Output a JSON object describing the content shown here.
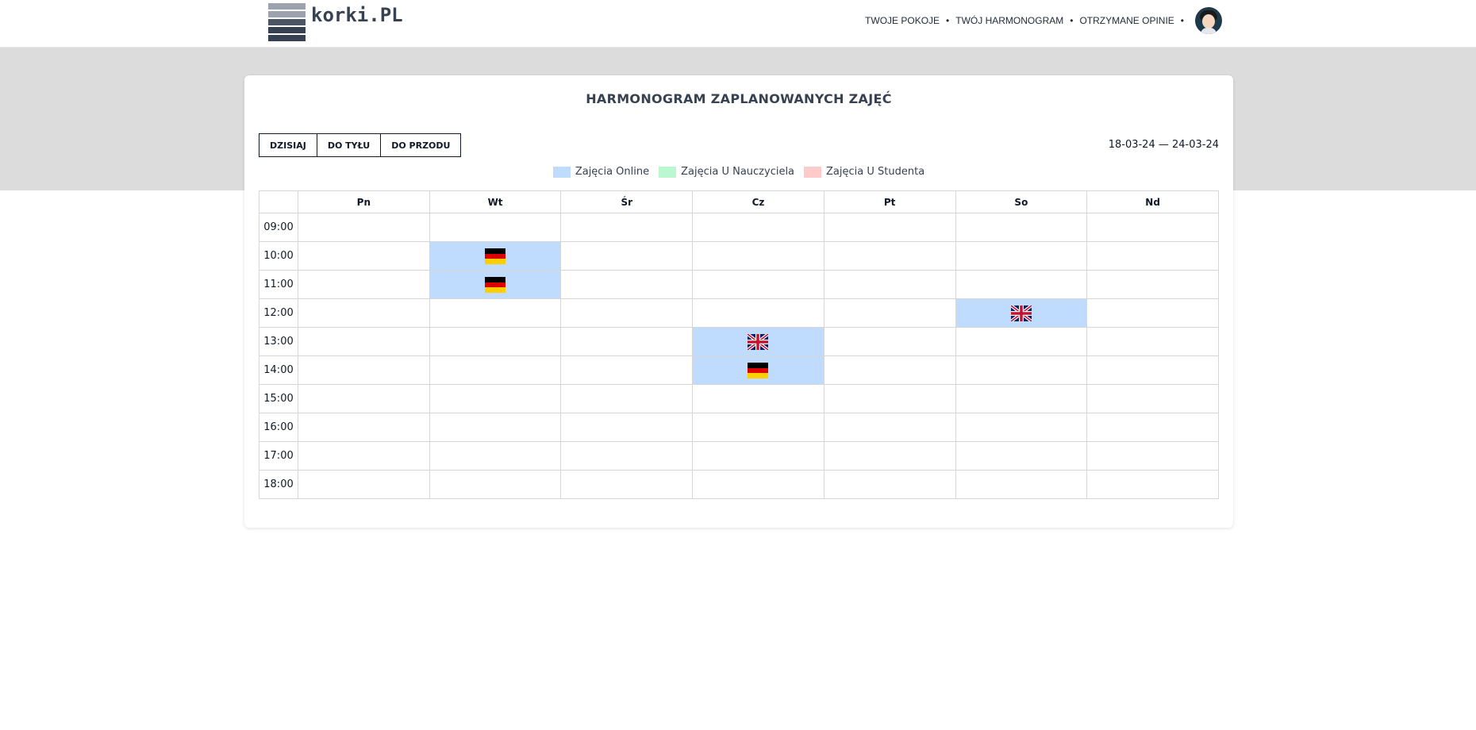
{
  "header": {
    "logo_text": "korki.PL",
    "nav": [
      {
        "label": "TWOJE POKOJE"
      },
      {
        "label": "TWÓJ HARMONOGRAM"
      },
      {
        "label": "OTRZYMANE OPINIE"
      }
    ],
    "nav_separator": "•"
  },
  "schedule": {
    "title": "HARMONOGRAM ZAPLANOWANYCH ZAJĘĆ",
    "buttons": {
      "today": "DZISIAJ",
      "back": "DO TYŁU",
      "forward": "DO PRZODU"
    },
    "date_range": "18-03-24 — 24-03-24",
    "legend": [
      {
        "label": "Zajęcia Online",
        "color": "#bfdbfe"
      },
      {
        "label": "Zajęcia U Nauczyciela",
        "color": "#bbf7d0"
      },
      {
        "label": "Zajęcia U Studenta",
        "color": "#fecaca"
      }
    ],
    "days": [
      "Pn",
      "Wt",
      "Śr",
      "Cz",
      "Pt",
      "So",
      "Nd"
    ],
    "hours": [
      "09:00",
      "10:00",
      "11:00",
      "12:00",
      "13:00",
      "14:00",
      "15:00",
      "16:00",
      "17:00",
      "18:00"
    ],
    "lessons": [
      {
        "day": "Wt",
        "hour": "10:00",
        "type": "online",
        "flag": "germany-flag-icon"
      },
      {
        "day": "Wt",
        "hour": "11:00",
        "type": "online",
        "flag": "germany-flag-icon"
      },
      {
        "day": "So",
        "hour": "12:00",
        "type": "online",
        "flag": "uk-flag-icon"
      },
      {
        "day": "Cz",
        "hour": "13:00",
        "type": "online",
        "flag": "uk-flag-icon"
      },
      {
        "day": "Cz",
        "hour": "14:00",
        "type": "online",
        "flag": "germany-flag-icon"
      }
    ]
  }
}
